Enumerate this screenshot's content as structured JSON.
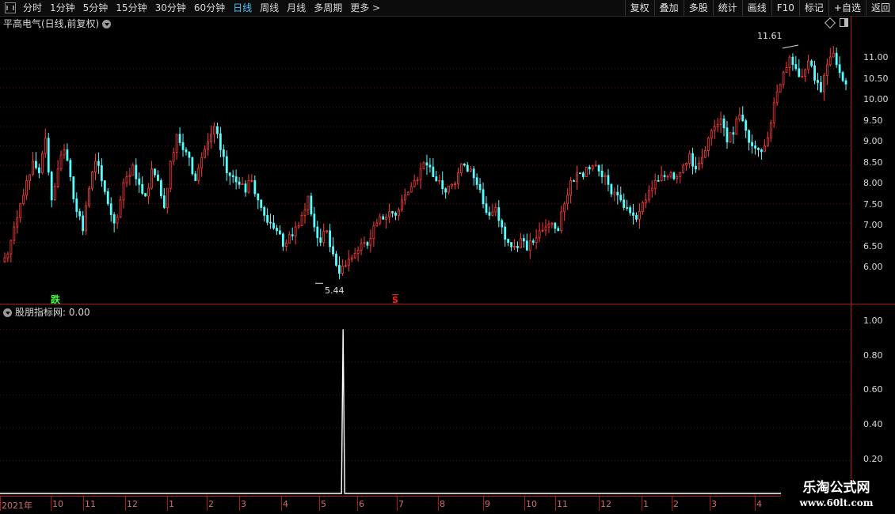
{
  "toolbar": {
    "periods": [
      "分时",
      "1分钟",
      "5分钟",
      "15分钟",
      "30分钟",
      "60分钟",
      "日线",
      "周线",
      "月线",
      "多周期",
      "更多 >"
    ],
    "active_period": "日线",
    "buttons": [
      "复权",
      "叠加",
      "多股",
      "统计",
      "画线",
      "F10",
      "标记",
      "+自选",
      "返回"
    ]
  },
  "main_pane": {
    "title": "平高电气(日线,前复权)",
    "y_ticks": [
      "11.00",
      "10.50",
      "10.00",
      "9.50",
      "9.00",
      "8.50",
      "8.00",
      "7.50",
      "7.00",
      "6.50",
      "6.00"
    ],
    "high_marker": "11.61",
    "low_marker": "5.44",
    "signal_jump": "跌",
    "signal_s": "S"
  },
  "indicator_pane": {
    "title": "股朋指标网",
    "value": ": 0.00",
    "y_ticks": [
      "1.00",
      "0.80",
      "0.60",
      "0.40",
      "0.20"
    ]
  },
  "x_axis": {
    "labels": [
      "2021年",
      "10",
      "11",
      "12",
      "1",
      "2",
      "3",
      "4",
      "5",
      "6",
      "7",
      "8",
      "9",
      "10",
      "11",
      "12",
      "1",
      "2",
      "3",
      "4"
    ]
  },
  "colors": {
    "up": "#ff3c3c",
    "down": "#54ffff",
    "axis": "#b01818",
    "active": "#4fc3ff"
  },
  "chart_data": [
    {
      "type": "candlestick",
      "title": "平高电气(日线,前复权)",
      "ylim": [
        5.2,
        12.0
      ],
      "y_ticks": [
        6.0,
        6.5,
        7.0,
        7.5,
        8.0,
        8.5,
        9.0,
        9.5,
        10.0,
        10.5,
        11.0
      ],
      "closes": [
        6.2,
        6.9,
        7.5,
        8.1,
        8.6,
        8.3,
        9.2,
        7.6,
        8.4,
        8.9,
        8.2,
        7.3,
        6.8,
        7.9,
        8.6,
        8.1,
        7.5,
        7.0,
        7.6,
        8.2,
        8.5,
        8.0,
        7.7,
        8.4,
        8.1,
        7.4,
        8.6,
        9.3,
        8.9,
        8.7,
        8.1,
        8.7,
        9.1,
        9.5,
        8.9,
        8.3,
        8.2,
        8.0,
        7.8,
        8.1,
        7.6,
        7.2,
        7.0,
        6.8,
        6.4,
        6.7,
        6.9,
        7.2,
        7.7,
        6.9,
        6.5,
        6.8,
        6.2,
        5.7,
        5.9,
        6.1,
        6.3,
        6.5,
        6.6,
        7.0,
        7.1,
        7.3,
        7.2,
        7.6,
        7.8,
        8.1,
        8.4,
        8.5,
        8.2,
        8.1,
        7.8,
        8.0,
        8.3,
        8.5,
        8.4,
        8.0,
        7.5,
        7.2,
        7.4,
        6.9,
        6.5,
        6.4,
        6.6,
        6.3,
        6.5,
        6.8,
        6.9,
        7.0,
        6.8,
        7.5,
        8.1,
        8.3,
        8.2,
        8.4,
        8.5,
        8.2,
        8.0,
        7.8,
        7.6,
        7.4,
        7.2,
        7.3,
        7.6,
        7.9,
        8.1,
        8.2,
        8.3,
        8.2,
        8.5,
        8.8,
        8.4,
        8.7,
        9.2,
        9.5,
        9.7,
        9.1,
        9.3,
        9.8,
        9.4,
        9.0,
        8.9,
        9.0,
        9.6,
        10.4,
        10.9,
        11.3,
        11.0,
        10.8,
        11.2,
        10.7,
        10.4,
        11.1,
        11.4,
        10.9,
        10.6
      ],
      "high_marker": 11.61,
      "low_marker": 5.44
    },
    {
      "type": "line",
      "title": "股朋指标网",
      "ylim": [
        0,
        1.05
      ],
      "y_ticks": [
        0.2,
        0.4,
        0.6,
        0.8,
        1.0
      ],
      "spike": {
        "bar_index": 54,
        "value": 1.0
      },
      "baseline": 0.0
    }
  ]
}
